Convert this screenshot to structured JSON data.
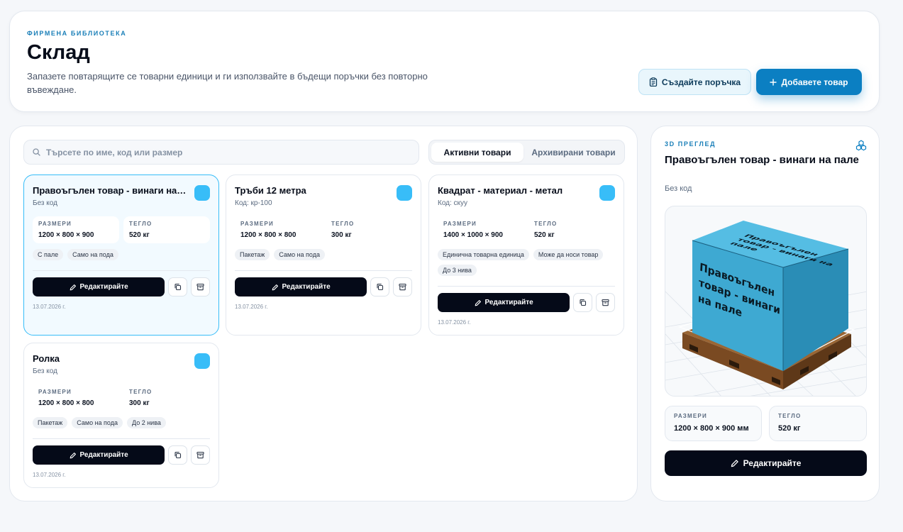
{
  "header": {
    "eyebrow": "ФИРМЕНА БИБЛИОТЕКА",
    "title": "Склад",
    "description": "Запазете повтарящите се товарни единици и ги използвайте в бъдещи поръчки без повторно въвеждане.",
    "create_order_label": "Създайте поръчка",
    "add_item_label": "Добавете товар"
  },
  "search": {
    "placeholder": "Търсете по име, код или размер"
  },
  "tabs": {
    "active": "Активни товари",
    "archived": "Архивирани товари"
  },
  "labels": {
    "dimensions": "РАЗМЕРИ",
    "weight": "ТЕГЛО",
    "edit": "Редактирайте"
  },
  "items": [
    {
      "title": "Правоъгълен товар - винаги на пале",
      "code": "Без код",
      "dimensions": "1200 × 800 × 900",
      "weight": "520 кг",
      "tags": [
        "С пале",
        "Само на пода"
      ],
      "date": "13.07.2026 г.",
      "color": "#38bdf8"
    },
    {
      "title": "Тръби 12 метра",
      "code": "Код: кр-100",
      "dimensions": "1200 × 800 × 800",
      "weight": "300 кг",
      "tags": [
        "Пакетаж",
        "Само на пода"
      ],
      "date": "13.07.2026 г.",
      "color": "#38bdf8"
    },
    {
      "title": "Квадрат - материал - метал",
      "code": "Код: скуу",
      "dimensions": "1400 × 1000 × 900",
      "weight": "520 кг",
      "tags": [
        "Единична товарна единица",
        "Може да носи товар",
        "До 3 нива"
      ],
      "date": "13.07.2026 г.",
      "color": "#38bdf8"
    },
    {
      "title": "Ролка",
      "code": "Без код",
      "dimensions": "1200 × 800 × 800",
      "weight": "300 кг",
      "tags": [
        "Пакетаж",
        "Само на пода",
        "До 2 нива"
      ],
      "date": "13.07.2026 г.",
      "color": "#38bdf8"
    }
  ],
  "preview": {
    "eyebrow": "3D ПРЕГЛЕД",
    "title": "Правоъгълен товар - винаги на пале",
    "code": "Без код",
    "box_front_lines": [
      "Правоъгълен",
      "товар - винаги",
      "на пале"
    ],
    "box_top_lines": [
      "Правоъгълен",
      "товар - винаги на",
      "пале"
    ],
    "dimensions_label": "РАЗМЕРИ",
    "dimensions": "1200 × 800 × 900 мм",
    "weight_label": "ТЕГЛО",
    "weight": "520 кг",
    "edit_label": "Редактирайте"
  },
  "colors": {
    "accent": "#0b7fc2",
    "box": "#3ea9d2",
    "pallet": "#8b5a2b"
  }
}
